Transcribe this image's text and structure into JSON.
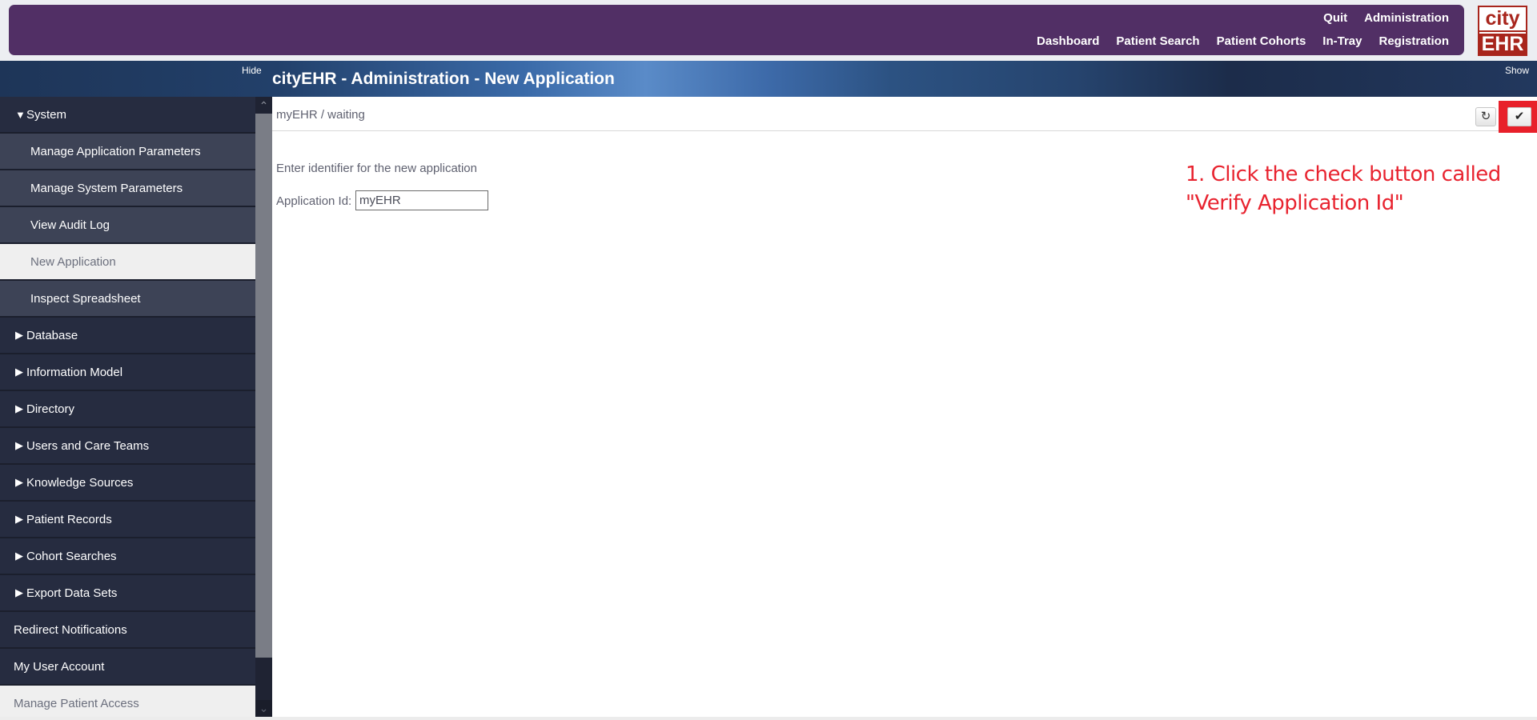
{
  "header": {
    "nav_row1": [
      {
        "label": "Quit"
      },
      {
        "label": "Administration"
      }
    ],
    "nav_row2": [
      {
        "label": "Dashboard"
      },
      {
        "label": "Patient Search"
      },
      {
        "label": "Patient Cohorts"
      },
      {
        "label": "In-Tray"
      },
      {
        "label": "Registration"
      }
    ],
    "logo": {
      "top": "city",
      "bottom": "EHR"
    },
    "brand_color": "#512f65",
    "logo_color": "#a8251c"
  },
  "titlebar": {
    "hide_label": "Hide",
    "show_label": "Show",
    "title": "cityEHR - Administration - New Application"
  },
  "sidebar": {
    "items": [
      {
        "label": "System",
        "type": "section",
        "expanded": true,
        "icon": "triangle-down-icon",
        "glyph": "▼"
      },
      {
        "label": "Manage Application Parameters",
        "type": "sub"
      },
      {
        "label": "Manage System Parameters",
        "type": "sub"
      },
      {
        "label": "View Audit Log",
        "type": "sub"
      },
      {
        "label": "New Application",
        "type": "sub",
        "active": true
      },
      {
        "label": "Inspect Spreadsheet",
        "type": "sub"
      },
      {
        "label": "Database",
        "type": "section",
        "expanded": false,
        "icon": "triangle-right-icon",
        "glyph": "▶"
      },
      {
        "label": "Information Model",
        "type": "section",
        "expanded": false,
        "icon": "triangle-right-icon",
        "glyph": "▶"
      },
      {
        "label": "Directory",
        "type": "section",
        "expanded": false,
        "icon": "triangle-right-icon",
        "glyph": "▶"
      },
      {
        "label": "Users and Care Teams",
        "type": "section",
        "expanded": false,
        "icon": "triangle-right-icon",
        "glyph": "▶"
      },
      {
        "label": "Knowledge Sources",
        "type": "section",
        "expanded": false,
        "icon": "triangle-right-icon",
        "glyph": "▶"
      },
      {
        "label": "Patient Records",
        "type": "section",
        "expanded": false,
        "icon": "triangle-right-icon",
        "glyph": "▶"
      },
      {
        "label": "Cohort Searches",
        "type": "section",
        "expanded": false,
        "icon": "triangle-right-icon",
        "glyph": "▶"
      },
      {
        "label": "Export Data Sets",
        "type": "section",
        "expanded": false,
        "icon": "triangle-right-icon",
        "glyph": "▶"
      },
      {
        "label": "Redirect Notifications",
        "type": "top"
      },
      {
        "label": "My User Account",
        "type": "top"
      },
      {
        "label": "Manage Patient Access",
        "type": "top",
        "active": true
      }
    ]
  },
  "scrollbar": {
    "up_glyph": "⌃",
    "down_glyph": "⌄"
  },
  "content": {
    "breadcrumb": "myEHR / waiting",
    "refresh_button": {
      "icon": "refresh-icon",
      "glyph": "↻"
    },
    "verify_button": {
      "icon": "check-icon",
      "glyph": "✔",
      "name": "Verify Application Id"
    },
    "instruction": "Enter identifier for the new application",
    "app_id_label": "Application Id:",
    "app_id_value": "myEHR"
  },
  "annotation": {
    "line1": "1. Click the check button called",
    "line2": "\"Verify Application Id\"",
    "color": "#e8232f"
  }
}
